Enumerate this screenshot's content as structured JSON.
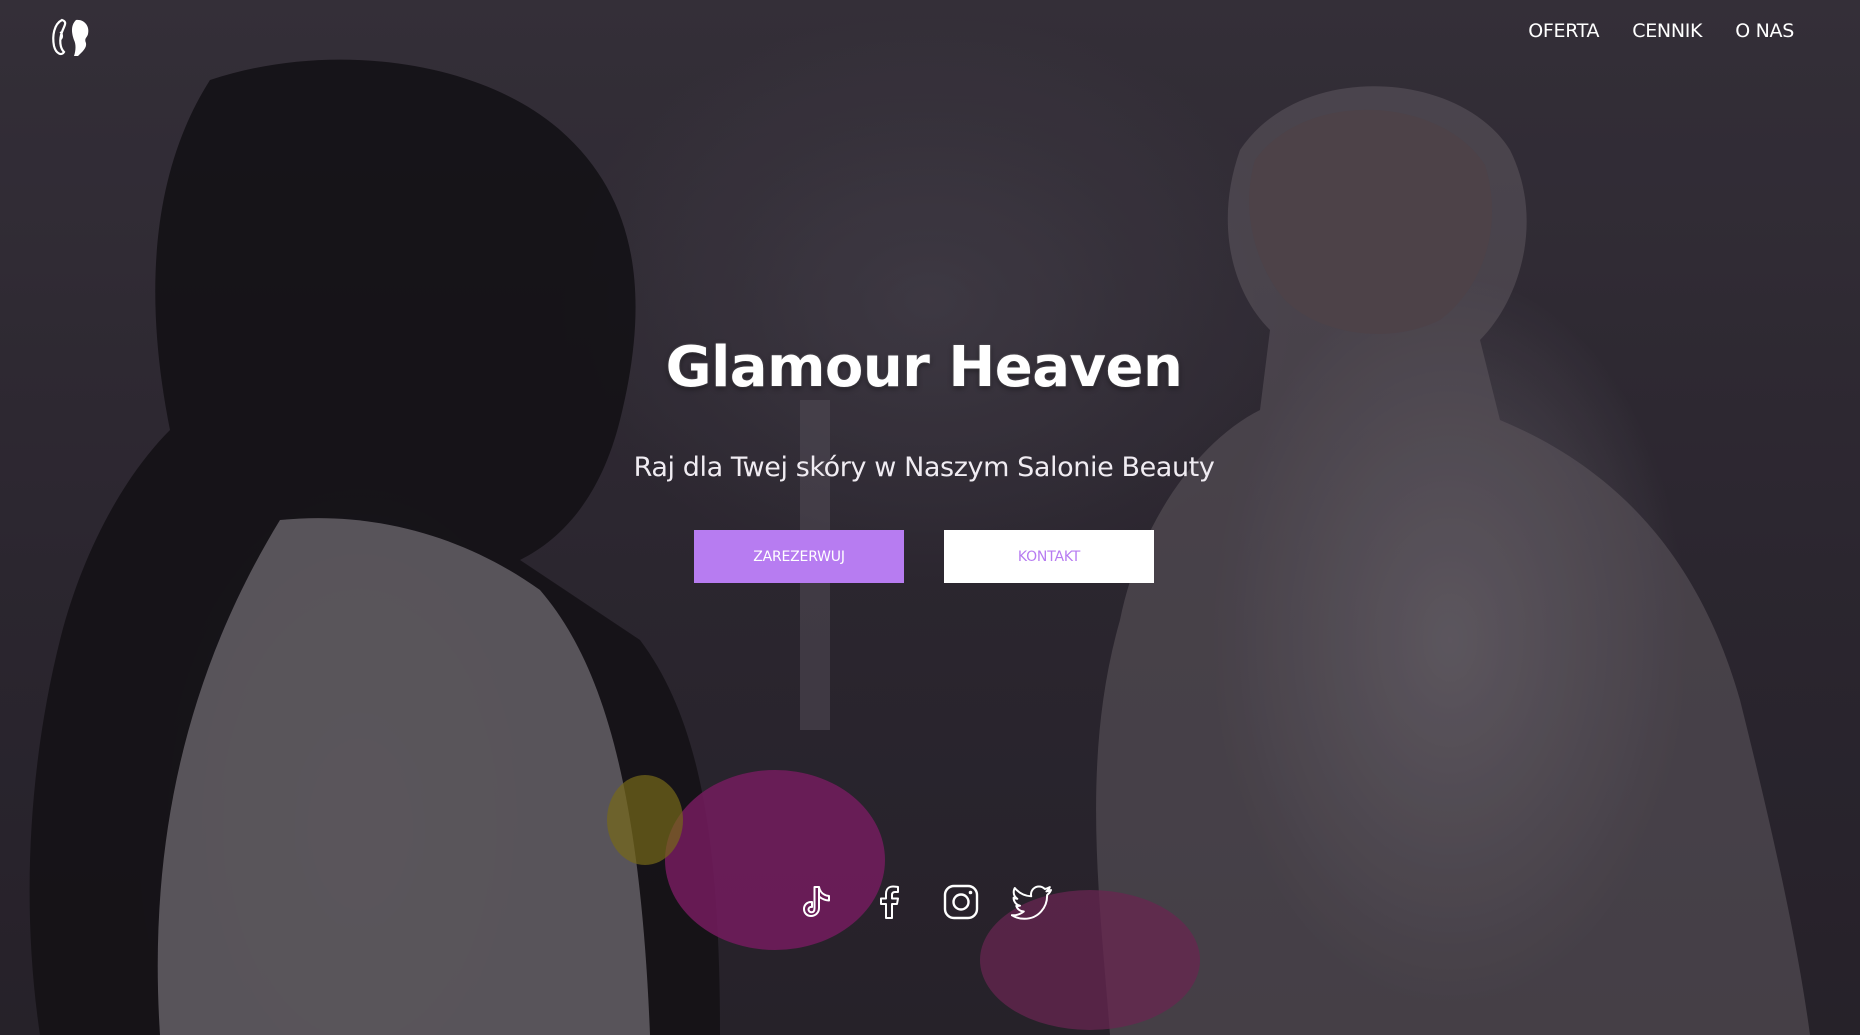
{
  "nav": {
    "items": [
      {
        "label": "OFERTA"
      },
      {
        "label": "CENNIK"
      },
      {
        "label": "O NAS"
      }
    ]
  },
  "hero": {
    "title": "Glamour Heaven",
    "subtitle": "Raj dla Twej skóry w Naszym Salonie Beauty",
    "primary_button": "ZAREZERWUJ",
    "secondary_button": "KONTAKT"
  },
  "social": [
    {
      "icon": "tiktok-icon"
    },
    {
      "icon": "facebook-icon"
    },
    {
      "icon": "instagram-icon"
    },
    {
      "icon": "twitter-icon"
    }
  ],
  "colors": {
    "accent": "#b77cf1",
    "text": "#ffffff"
  }
}
